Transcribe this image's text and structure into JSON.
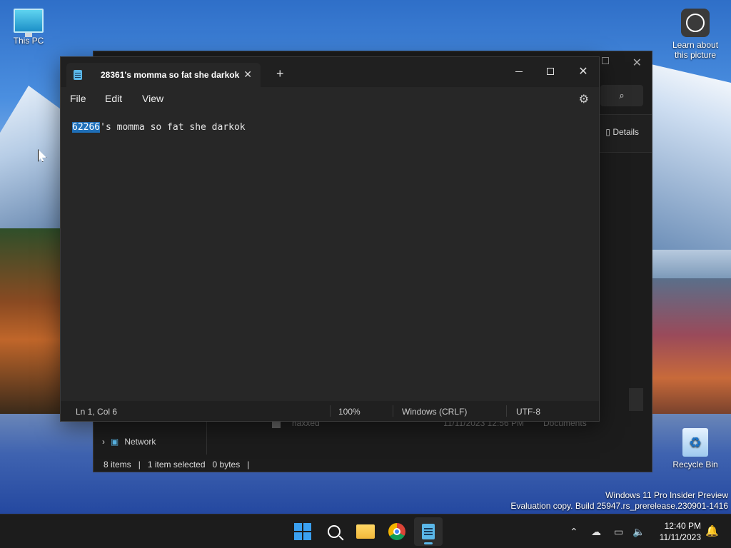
{
  "desktop": {
    "this_pc": "This PC",
    "learn": "Learn about this picture",
    "recycle_bin": "Recycle Bin"
  },
  "explorer": {
    "details_label": "Details",
    "file_name": "haxxed",
    "file_date": "11/11/2023 12:56 PM",
    "file_location": "Documents",
    "network_label": "Network",
    "status_items": "8 items",
    "status_selected": "1 item selected",
    "status_size": "0 bytes"
  },
  "notepad": {
    "tab_title": "28361's momma so fat she darkok",
    "menu": {
      "file": "File",
      "edit": "Edit",
      "view": "View"
    },
    "editor": {
      "selected_text": "62266",
      "rest_text": "'s momma so fat she darkok"
    },
    "status": {
      "position": "Ln 1, Col 6",
      "zoom": "100%",
      "line_ending": "Windows (CRLF)",
      "encoding": "UTF-8"
    }
  },
  "watermark": {
    "line1": "Windows 11 Pro Insider Preview",
    "line2": "Evaluation copy. Build 25947.rs_prerelease.230901-1416"
  },
  "taskbar": {
    "time": "12:40 PM",
    "date": "11/11/2023"
  },
  "icons": {
    "start": "windows-start-icon",
    "search": "search-icon",
    "explorer": "folder-icon",
    "chrome": "chrome-icon",
    "notepad": "notepad-icon"
  },
  "colors": {
    "accent": "#5ab7e8",
    "selection": "#1f6fb8"
  }
}
